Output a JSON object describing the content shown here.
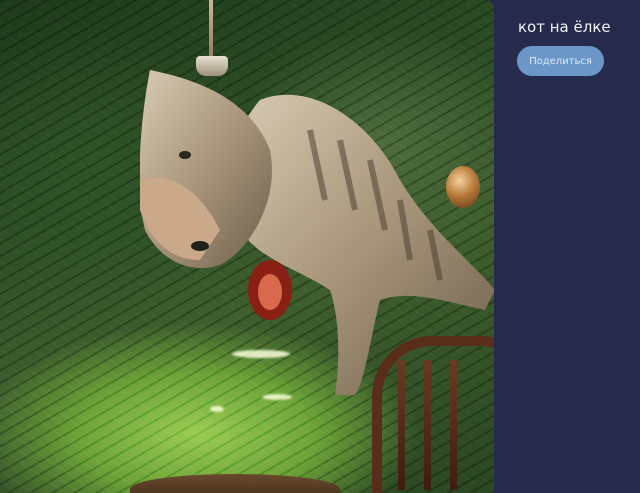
{
  "post": {
    "caption": "кот на ёлке",
    "share_label": "Поделиться"
  },
  "image": {
    "subject": "cat-in-christmas-tree-photo"
  },
  "colors": {
    "sidebar_background": "#262b4d",
    "button_background": "#6b97c8",
    "caption_text": "#f2f3f8"
  }
}
